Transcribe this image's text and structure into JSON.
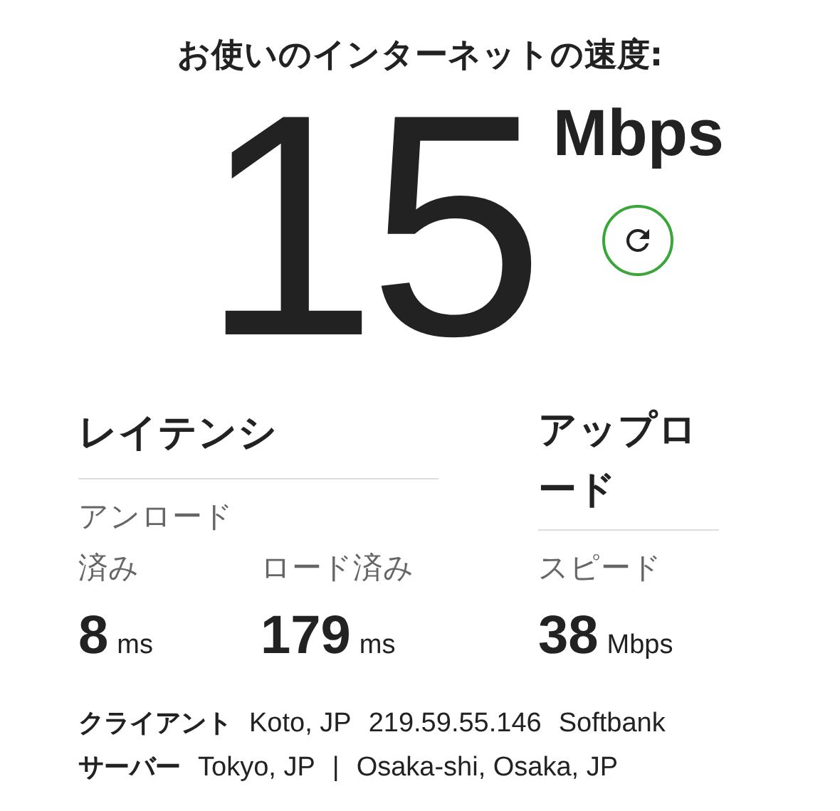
{
  "title": "お使いのインターネットの速度:",
  "speed": {
    "value": "15",
    "unit": "Mbps"
  },
  "latency": {
    "heading": "レイテンシ",
    "metrics": [
      {
        "label": "アンロード済み",
        "value": "8",
        "unit": "ms"
      },
      {
        "label": "ロード済み",
        "value": "179",
        "unit": "ms"
      }
    ]
  },
  "upload": {
    "heading": "アップロード",
    "metrics": [
      {
        "label": "スピード",
        "value": "38",
        "unit": "Mbps"
      }
    ]
  },
  "info": [
    {
      "label": "クライアント",
      "values": [
        "Koto, JP",
        "219.59.55.146",
        "Softbank"
      ]
    },
    {
      "label": "サーバー",
      "values": [
        "Tokyo, JP",
        "|",
        "Osaka-shi, Osaka, JP"
      ]
    }
  ]
}
